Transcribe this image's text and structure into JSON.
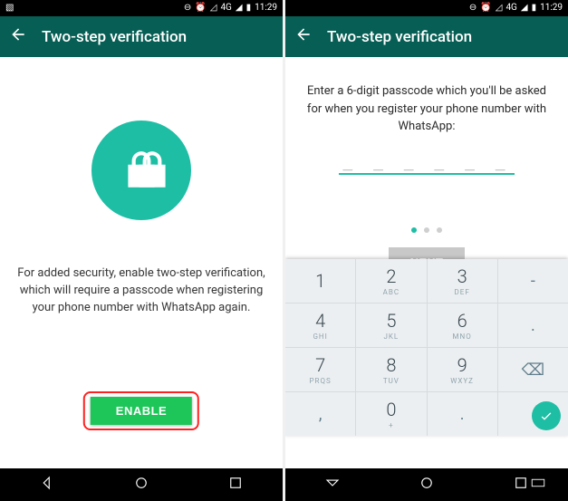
{
  "status": {
    "network": "4G",
    "time": "11:29"
  },
  "screen1": {
    "title": "Two-step verification",
    "description": "For added security, enable two-step verification, which will require a passcode when registering your phone number with WhatsApp again.",
    "enable_label": "ENABLE"
  },
  "screen2": {
    "title": "Two-step verification",
    "instruction": "Enter a 6-digit passcode which you'll be asked for when you register your phone number with WhatsApp:",
    "pin_placeholder": "_ _ _   _ _ _",
    "next_label": "NEXT",
    "keypad": [
      [
        {
          "n": "1",
          "l": ""
        },
        {
          "n": "2",
          "l": "ABC"
        },
        {
          "n": "3",
          "l": "DEF"
        },
        {
          "n": "-",
          "l": ""
        }
      ],
      [
        {
          "n": "4",
          "l": "GHI"
        },
        {
          "n": "5",
          "l": "JKL"
        },
        {
          "n": "6",
          "l": "MNO"
        },
        {
          "n": ".",
          "l": ""
        }
      ],
      [
        {
          "n": "7",
          "l": "PRQS"
        },
        {
          "n": "8",
          "l": "TUV"
        },
        {
          "n": "9",
          "l": "WXYZ"
        },
        {
          "n": "⌫",
          "l": ""
        }
      ],
      [
        {
          "n": ",",
          "l": ""
        },
        {
          "n": "0",
          "l": "+"
        },
        {
          "n": ".",
          "l": ""
        },
        {
          "n": "✓",
          "l": ""
        }
      ]
    ]
  }
}
